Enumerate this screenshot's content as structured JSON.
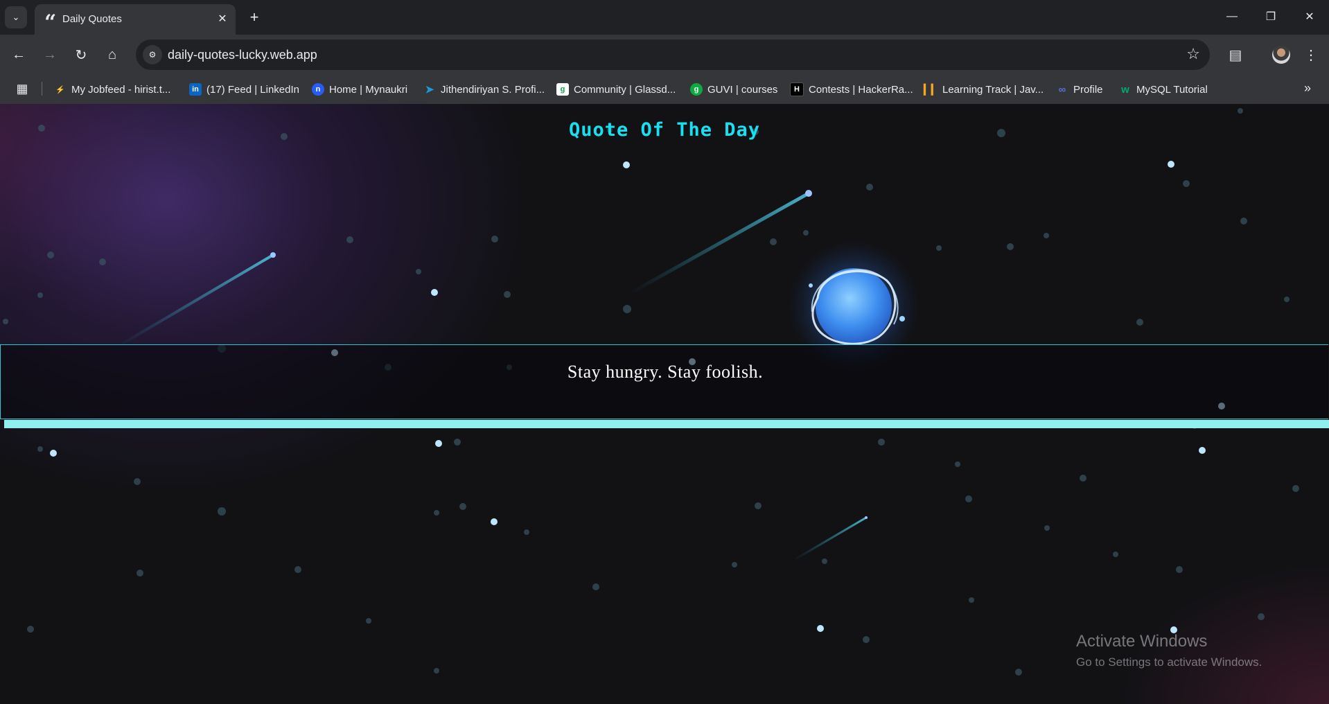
{
  "browser": {
    "tab": {
      "title": "Daily Quotes",
      "favicon": "quote-icon"
    },
    "address_bar": {
      "url": "daily-quotes-lucky.web.app"
    },
    "bookmarks": [
      {
        "label": "My Jobfeed - hirist.t...",
        "icon": "runner-icon",
        "color": "#e8eaed"
      },
      {
        "label": "(17) Feed | LinkedIn",
        "icon": "linkedin-icon",
        "color": "#0a66c2"
      },
      {
        "label": "Home | Mynaukri",
        "icon": "naukri-icon",
        "color": "#275df5"
      },
      {
        "label": "Jithendiriyan S. Profi...",
        "icon": "bird-icon",
        "color": "#1a9bd7"
      },
      {
        "label": "Community | Glassd...",
        "icon": "glassdoor-icon",
        "color": "#0caa41"
      },
      {
        "label": "GUVI | courses",
        "icon": "guvi-icon",
        "color": "#0caa41"
      },
      {
        "label": "Contests | HackerRa...",
        "icon": "hackerrank-icon",
        "color": "#000000"
      },
      {
        "label": "Learning Track | Jav...",
        "icon": "bars-icon",
        "color": "#f5a623"
      },
      {
        "label": "Profile",
        "icon": "profile-icon",
        "color": "#5b6ee1"
      },
      {
        "label": "MySQL Tutorial",
        "icon": "w3-icon",
        "color": "#04aa6d"
      }
    ]
  },
  "page": {
    "title": "Quote Of The Day",
    "quote": "Stay hungry. Stay foolish.",
    "accent_color": "#18e0f0",
    "bar_color": "#8ff0ef"
  },
  "watermark": {
    "line1": "Activate Windows",
    "line2": "Go to Settings to activate Windows."
  }
}
